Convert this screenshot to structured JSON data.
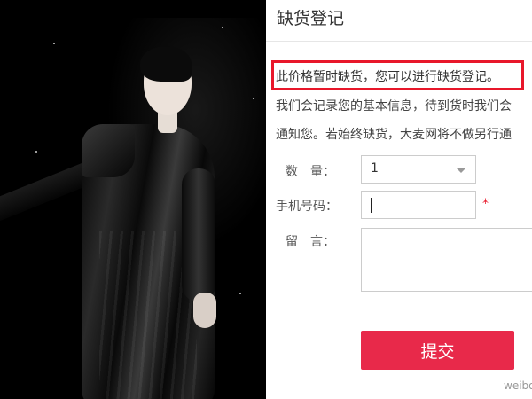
{
  "dialog": {
    "title": "缺货登记",
    "notice": "此价格暂时缺货，您可以进行缺货登记。",
    "desc_line1": "我们会记录您的基本信息，待到货时我们会",
    "desc_line2": "通知您。若始终缺货，大麦网将不做另行通"
  },
  "form": {
    "quantity_label": "数　量：",
    "quantity_value": "1",
    "phone_label": "手机号码：",
    "required_mark": "*",
    "message_label": "留　言：",
    "submit_label": "提交"
  },
  "watermark": "weibo",
  "colors": {
    "accent_red": "#e8172a",
    "button_red": "#e8294a"
  }
}
